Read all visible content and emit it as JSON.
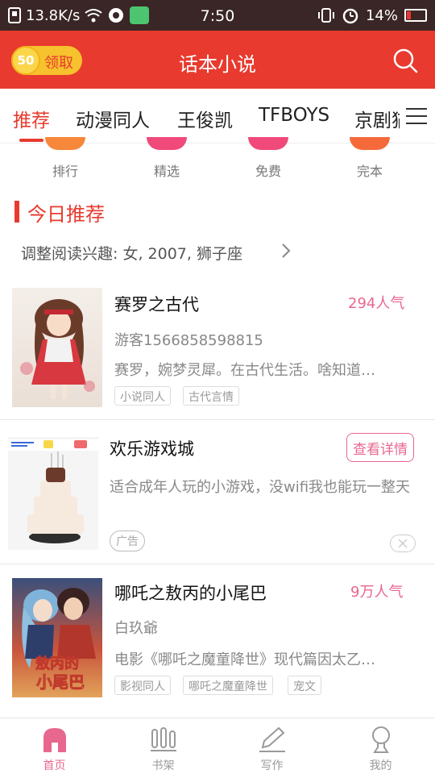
{
  "status_bar": {
    "net_speed": "13.8K/s",
    "time": "7:50",
    "battery": "14%"
  },
  "header": {
    "coins": "50",
    "claim_label": "领取",
    "title": "话本小说"
  },
  "tabs": [
    "推荐",
    "动漫同人",
    "王俊凯",
    "TFBOYS",
    "京剧猫"
  ],
  "categories": [
    {
      "label": "排行",
      "color": "#f7873a"
    },
    {
      "label": "精选",
      "color": "#ef4a7a"
    },
    {
      "label": "免费",
      "color": "#ef4a7a"
    },
    {
      "label": "完本",
      "color": "#f56a3a"
    }
  ],
  "section": {
    "title": "今日推荐",
    "interest": "调整阅读兴趣: 女, 2007, 狮子座"
  },
  "books": [
    {
      "title": "赛罗之古代",
      "popularity": "294人气",
      "author": "游客1566858598815",
      "desc": "赛罗，婉梦灵犀。在古代生活。啥知道…",
      "tags": [
        "小说同人",
        "古代言情"
      ]
    },
    {
      "title": "哪吒之敖丙的小尾巴",
      "popularity": "9万人气",
      "author": "白玖爺",
      "desc": "电影《哪吒之魔童降世》现代篇因太乙…",
      "tags": [
        "影视同人",
        "哪吒之魔童降世",
        "宠文"
      ],
      "cover_text": "敖丙的小尾巴"
    }
  ],
  "ad": {
    "title": "欢乐游戏城",
    "detail_label": "查看详情",
    "desc": "适合成年人玩的小游戏，没wifi我也能玩一整天",
    "badge": "广告"
  },
  "bottom_nav": [
    {
      "label": "首页",
      "icon": "home-icon",
      "active": true
    },
    {
      "label": "书架",
      "icon": "bookshelf-icon",
      "active": false
    },
    {
      "label": "写作",
      "icon": "pen-icon",
      "active": false
    },
    {
      "label": "我的",
      "icon": "profile-icon",
      "active": false
    }
  ],
  "colors": {
    "brand_red": "#e83a2e",
    "accent_pink": "#e8678f",
    "coin_gold": "#f6c22d"
  }
}
